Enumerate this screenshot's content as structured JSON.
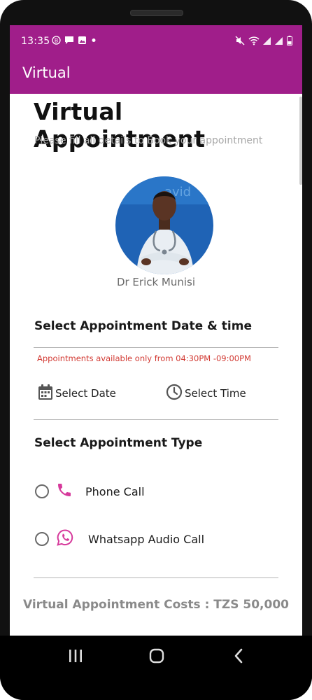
{
  "status_bar": {
    "time": "13:35",
    "left_icons": [
      "b-badge-icon",
      "message-icon",
      "image-icon",
      "dot-icon"
    ],
    "right_icons": [
      "mute-icon",
      "wifi-icon",
      "signal-icon",
      "signal-icon",
      "battery-icon"
    ]
  },
  "app_bar": {
    "title": "Virtual"
  },
  "header": {
    "title": "Virtual Appointment",
    "subtitle": "Please fill all details to Book your appointment"
  },
  "doctor": {
    "name": "Dr Erick Munisi",
    "avatar_bg_text": "avid"
  },
  "date_time_section": {
    "title": "Select Appointment Date & time",
    "notice": "Appointments available only from 04:30PM -09:00PM",
    "select_date_label": "Select Date",
    "select_time_label": "Select Time"
  },
  "type_section": {
    "title": "Select Appointment Type",
    "options": [
      {
        "label": "Phone Call",
        "icon": "phone-icon"
      },
      {
        "label": "Whatsapp Audio Call",
        "icon": "whatsapp-icon"
      }
    ]
  },
  "cost": {
    "text": "Virtual Appointment Costs : TZS 50,000"
  },
  "nav_bar": {
    "buttons": [
      "recents-icon",
      "home-icon",
      "back-icon"
    ]
  },
  "colors": {
    "primary": "#a01e8a",
    "icon_accent": "#d6399b",
    "notice_red": "#d23a33",
    "avatar_bg": "#1f63b5"
  }
}
